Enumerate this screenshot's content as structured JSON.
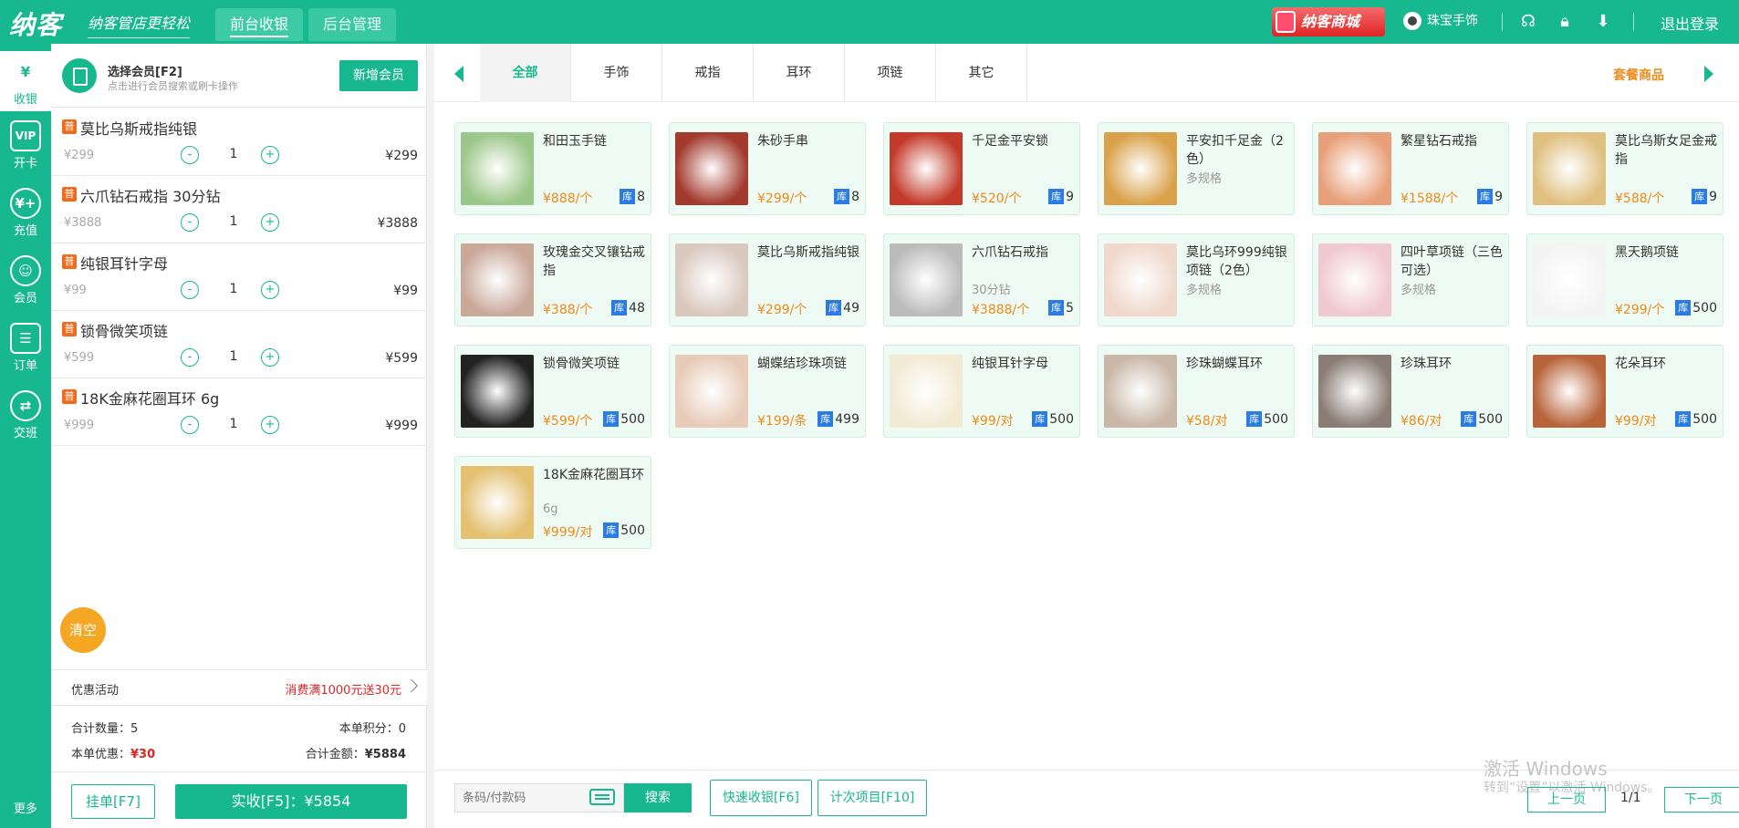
{
  "header": {
    "logo": "纳客",
    "slogan": "纳客管店更轻松",
    "tabs": [
      "前台收银",
      "后台管理"
    ],
    "mall": "纳客商城",
    "user": "珠宝手饰",
    "logout": "退出登录"
  },
  "sidenav": {
    "items": [
      {
        "label": "收银",
        "icon": "cash-register-icon",
        "glyph": "¥"
      },
      {
        "label": "开卡",
        "icon": "vip-card-icon",
        "glyph": "VIP"
      },
      {
        "label": "充值",
        "icon": "recharge-icon",
        "glyph": "¥+"
      },
      {
        "label": "会员",
        "icon": "member-icon",
        "glyph": "☺"
      },
      {
        "label": "订单",
        "icon": "order-icon",
        "glyph": "☰"
      },
      {
        "label": "交班",
        "icon": "shift-icon",
        "glyph": "⇄"
      }
    ],
    "more": "更多"
  },
  "member": {
    "title": "选择会员[F2]",
    "subtitle": "点击进行会员搜索或刷卡操作",
    "add_button": "新增会员"
  },
  "cart": {
    "badge": "普",
    "items": [
      {
        "name": "莫比乌斯戒指纯银",
        "price": "¥299",
        "qty": "1",
        "subtotal": "¥299"
      },
      {
        "name": "六爪钻石戒指 30分钻",
        "price": "¥3888",
        "qty": "1",
        "subtotal": "¥3888"
      },
      {
        "name": "纯银耳针字母",
        "price": "¥99",
        "qty": "1",
        "subtotal": "¥99"
      },
      {
        "name": "锁骨微笑项链",
        "price": "¥599",
        "qty": "1",
        "subtotal": "¥599"
      },
      {
        "name": "18K金麻花圈耳环 6g",
        "price": "¥999",
        "qty": "1",
        "subtotal": "¥999"
      }
    ],
    "minus": "-",
    "plus": "+",
    "clear": "清空"
  },
  "summary": {
    "promo_label": "优惠活动",
    "promo_value": "消费满1000元送30元",
    "qty_label": "合计数量：",
    "qty_value": "5",
    "points_label": "本单积分：",
    "points_value": "0",
    "discount_label": "本单优惠：",
    "discount_value": "¥30",
    "total_label": "合计金额：",
    "total_value": "¥5884",
    "hold_button": "挂单[F7]",
    "pay_button": "实收[F5]：¥5854"
  },
  "categories": {
    "tabs": [
      "全部",
      "手饰",
      "戒指",
      "耳环",
      "项链",
      "其它"
    ],
    "combo": "套餐商品"
  },
  "stock_tag": "库",
  "products": [
    {
      "name": "和田玉手链",
      "spec": "",
      "price": "¥888/个",
      "stock": "8",
      "color": "#9cc78a"
    },
    {
      "name": "朱砂手串",
      "spec": "",
      "price": "¥299/个",
      "stock": "8",
      "color": "#a33a2e"
    },
    {
      "name": "千足金平安锁",
      "spec": "",
      "price": "¥520/个",
      "stock": "9",
      "color": "#c43a2a"
    },
    {
      "name": "平安扣千足金（2色）",
      "spec": "多规格",
      "price": "",
      "stock": "",
      "color": "#d9a24a"
    },
    {
      "name": "繁星钻石戒指",
      "spec": "",
      "price": "¥1588/个",
      "stock": "9",
      "color": "#e8a07a"
    },
    {
      "name": "莫比乌斯女足金戒指",
      "spec": "",
      "price": "¥588/个",
      "stock": "9",
      "color": "#e0c080"
    },
    {
      "name": "玫瑰金交叉镶钻戒指",
      "spec": "",
      "price": "¥388/个",
      "stock": "48",
      "color": "#c9a89a"
    },
    {
      "name": "莫比乌斯戒指纯银",
      "spec": "",
      "price": "¥299/个",
      "stock": "49",
      "color": "#d9c9bf"
    },
    {
      "name": "六爪钻石戒指",
      "spec": "30分钻",
      "price": "¥3888/个",
      "stock": "5",
      "color": "#bbbbbb"
    },
    {
      "name": "莫比乌环999纯银项链（2色）",
      "spec": "多规格",
      "price": "",
      "stock": "",
      "color": "#f0d8cc"
    },
    {
      "name": "四叶草项链（三色可选）",
      "spec": "多规格",
      "price": "",
      "stock": "",
      "color": "#f0c8d0"
    },
    {
      "name": "黑天鹅项链",
      "spec": "",
      "price": "¥299/个",
      "stock": "500",
      "color": "#f4f4f4"
    },
    {
      "name": "锁骨微笑项链",
      "spec": "",
      "price": "¥599/个",
      "stock": "500",
      "color": "#222222"
    },
    {
      "name": "蝴蝶结珍珠项链",
      "spec": "",
      "price": "¥199/条",
      "stock": "499",
      "color": "#e8cbb8"
    },
    {
      "name": "纯银耳针字母",
      "spec": "",
      "price": "¥99/对",
      "stock": "500",
      "color": "#f3ead4"
    },
    {
      "name": "珍珠蝴蝶耳环",
      "spec": "",
      "price": "¥58/对",
      "stock": "500",
      "color": "#c9b7a8"
    },
    {
      "name": "珍珠耳环",
      "spec": "",
      "price": "¥86/对",
      "stock": "500",
      "color": "#8a7d75"
    },
    {
      "name": "花朵耳环",
      "spec": "",
      "price": "¥99/对",
      "stock": "500",
      "color": "#b8643a"
    },
    {
      "name": "18K金麻花圈耳环",
      "spec": "6g",
      "price": "¥999/对",
      "stock": "500",
      "color": "#e4c070"
    }
  ],
  "bottom": {
    "barcode_placeholder": "条码/付款码",
    "search": "搜索",
    "quick_pay": "快速收银[F6]",
    "count_item": "计次项目[F10]",
    "watermark1": "激活 Windows",
    "watermark2": "转到“设置”以激活 Windows。",
    "prev": "上一页",
    "page": "1/1",
    "next": "下一页"
  }
}
